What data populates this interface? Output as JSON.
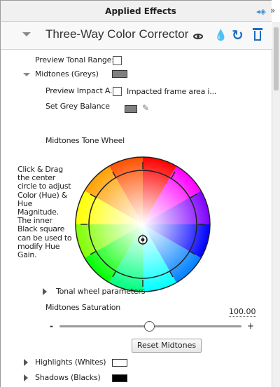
{
  "header": {
    "title": "Applied Effects"
  },
  "effect": {
    "title": "Three-Way Color Corrector"
  },
  "rows": {
    "preview_tonal_range": "Preview Tonal Range:",
    "midtones_section": "Midtones (Greys)",
    "preview_impact": "Preview Impact A...",
    "impacted_frame_area": "Impacted frame area i...",
    "set_grey_balance": "Set Grey Balance",
    "wheel_title": "Midtones Tone Wheel",
    "wheel_help": "Click & Drag the center circle to adjust Color (Hue) & Hue Magnitude. The inner Black square can be used to modify Hue Gain.",
    "tonal_wheel_parameters": "Tonal wheel parameters",
    "midtones_saturation": "Midtones Saturation",
    "saturation_value": "100.00",
    "slider_min": "-",
    "slider_max": "+",
    "reset_button": "Reset Midtones",
    "highlights_section": "Highlights (Whites)",
    "shadows_section": "Shadows (Blacks)"
  },
  "colors": {
    "accent": "#1a6fc4",
    "midtones_swatch": "#808080",
    "grey_balance_swatch": "#808080",
    "highlights_swatch": "#ffffff",
    "shadows_swatch": "#000000"
  },
  "icons": [
    "eye-icon",
    "drop-icon",
    "reset-icon",
    "trash-icon",
    "eyedropper-icon",
    "chevron-down-icon",
    "chevron-right-icon"
  ],
  "saturation_level": 0.5
}
